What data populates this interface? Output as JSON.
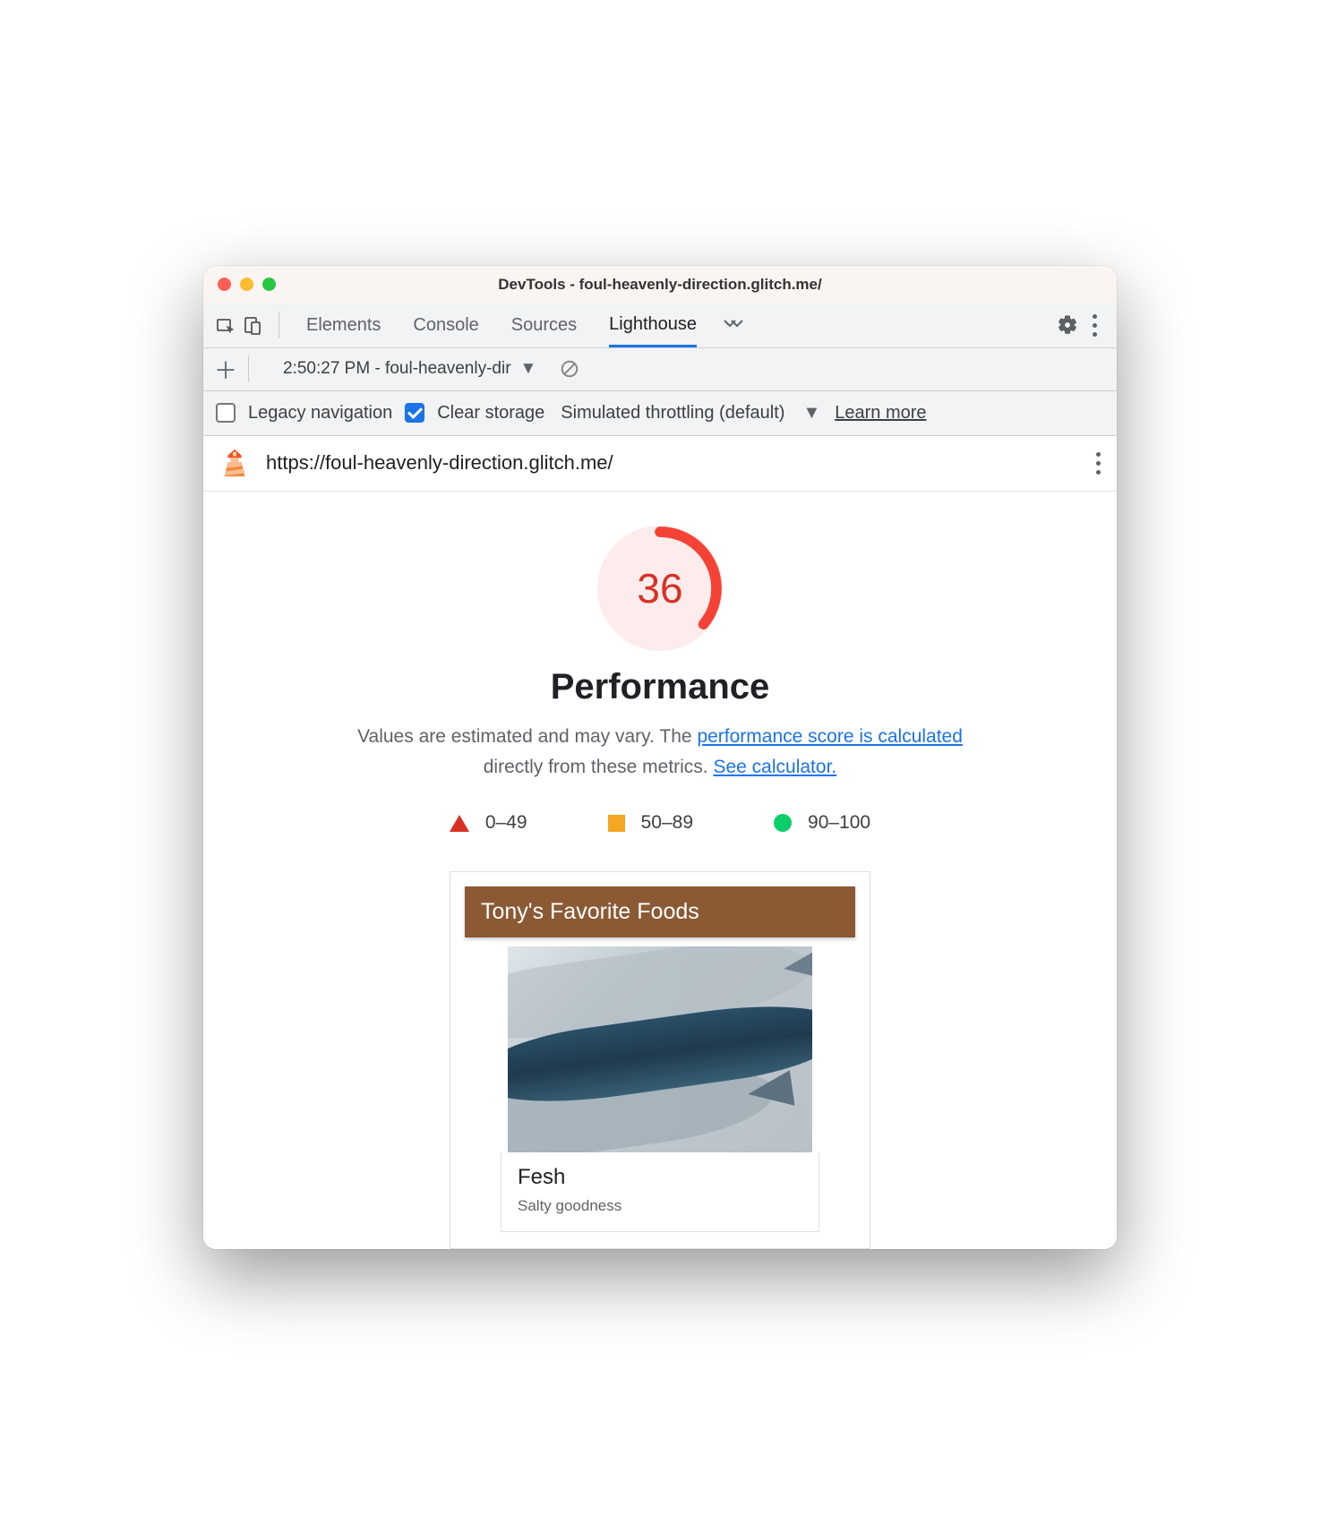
{
  "window": {
    "title": "DevTools - foul-heavenly-direction.glitch.me/"
  },
  "tabs": {
    "items": [
      "Elements",
      "Console",
      "Sources",
      "Lighthouse"
    ],
    "active_index": 3
  },
  "report_selector": {
    "label": "2:50:27 PM - foul-heavenly-dir"
  },
  "settings": {
    "legacy_nav": {
      "label": "Legacy navigation",
      "checked": false
    },
    "clear_storage": {
      "label": "Clear storage",
      "checked": true
    },
    "throttling": "Simulated throttling (default)",
    "learn_more": "Learn more"
  },
  "url": "https://foul-heavenly-direction.glitch.me/",
  "gauge": {
    "score": "36",
    "percent": 36
  },
  "performance": {
    "title": "Performance",
    "desc_1": "Values are estimated and may vary. The ",
    "link_1": "performance score is calculated",
    "desc_2": " directly from these metrics. ",
    "link_2": "See calculator."
  },
  "legend": {
    "bad": "0–49",
    "mid": "50–89",
    "good": "90–100"
  },
  "preview": {
    "header": "Tony's Favorite Foods",
    "item_title": "Fesh",
    "item_sub": "Salty goodness"
  }
}
